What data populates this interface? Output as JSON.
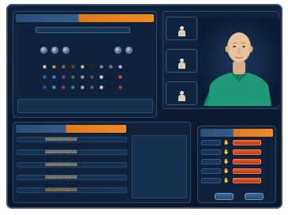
{
  "appearance_panel": {
    "title": "",
    "name_label": "",
    "name_value": "",
    "control_group_left_label": "",
    "control_group_right_label": "",
    "swatch_rows": [
      {
        "label": "",
        "colors": [
          "#d8d2c6",
          "#b79b7a",
          "#8a6a4e",
          "#6a4c35",
          "#cfc1a6",
          "#3f2a1e",
          "#9b8a6e",
          "#6e7f9a",
          "#c9b6d2"
        ]
      },
      {
        "label": "",
        "colors": [
          "#2e6db3",
          "#3a8ccf",
          "#7a3fa6",
          "#2d8a4a",
          "#a3a3a3",
          "#5b5b5b",
          "#e3e3e3",
          "#1e1e1e",
          "#c45a2b"
        ]
      },
      {
        "label": "",
        "colors": [
          "#1f5fa0",
          "#3fa0d8",
          "#8c3b9c",
          "#2f9b55",
          "#b3b3b3",
          "#666666",
          "#d9d9d9",
          "#222222",
          "#b0463a"
        ]
      }
    ],
    "note": ""
  },
  "pose_thumbnails": [
    {
      "label": ""
    },
    {
      "label": ""
    },
    {
      "label": ""
    }
  ],
  "avatar": {
    "shirt_color": "#1f9a7a",
    "skin_color": "#e7c29c"
  },
  "animation_panel": {
    "title": "",
    "rows": [
      {
        "label": "",
        "figures": "ꕤꕤꕤꕤꕤꕤꕤꕤꕤꕤꕤ"
      },
      {
        "label": "",
        "figures": "ꕤꕤꕤꕤꕤꕤꕤꕤꕤꕤꕤ"
      },
      {
        "label": "",
        "figures": "ꕤꕤꕤꕤꕤꕤꕤꕤꕤꕤꕤ"
      },
      {
        "label": "",
        "figures": "ꕤꕤꕤꕤꕤꕤꕤꕤꕤꕤꕤ"
      },
      {
        "label": "",
        "figures": "ꕤꕤꕤꕤꕤꕤꕤꕤꕤꕤꕤ"
      }
    ],
    "description": ""
  },
  "gesture_panel": {
    "title": "",
    "rows": [
      {
        "label": "",
        "icon": "hand-icon",
        "value": ""
      },
      {
        "label": "",
        "icon": "hand-icon",
        "value": ""
      },
      {
        "label": "",
        "icon": "hand-icon",
        "value": ""
      },
      {
        "label": "",
        "icon": "hand-icon",
        "value": ""
      },
      {
        "label": "",
        "icon": "hand-icon",
        "value": ""
      }
    ],
    "buttons": {
      "ok_label": "",
      "cancel_label": ""
    }
  },
  "colors": {
    "accent": "#f08a25",
    "frame": "#0f2038",
    "value_button": "#e35a2a"
  }
}
